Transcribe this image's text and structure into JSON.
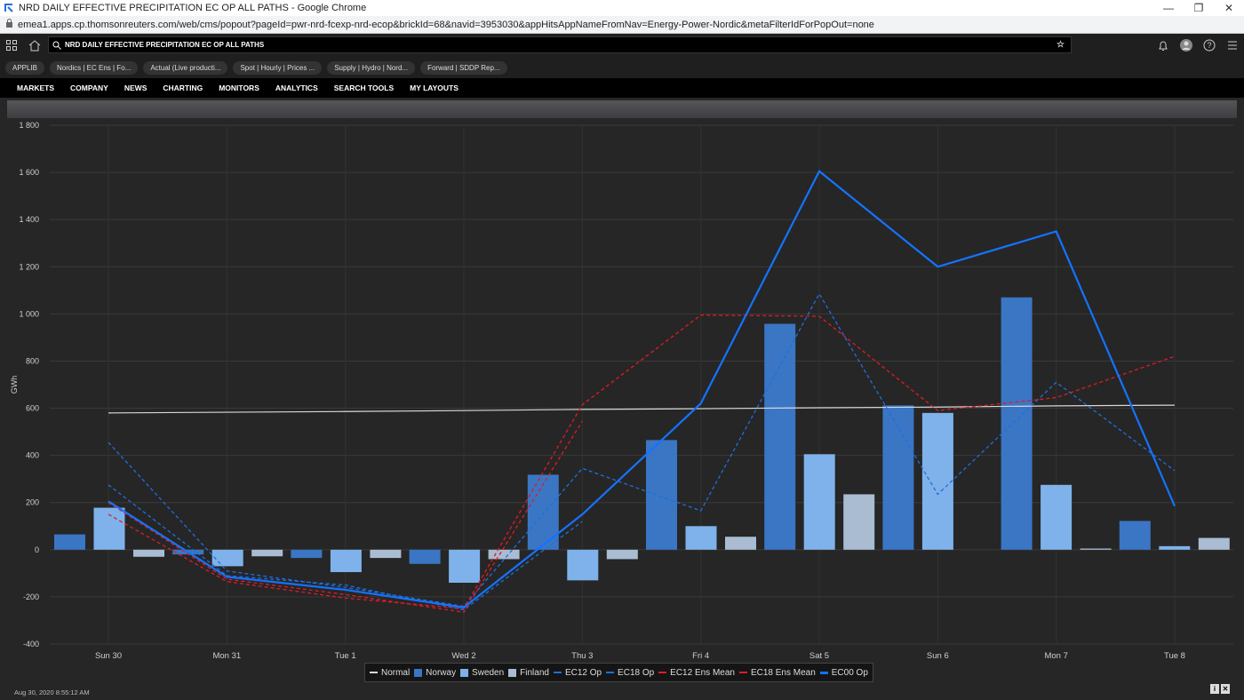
{
  "window": {
    "title": "NRD DAILY EFFECTIVE PRECIPITATION EC OP ALL PATHS - Google Chrome",
    "minimize": "—",
    "maximize": "❐",
    "close": "✕"
  },
  "browser": {
    "url": "emea1.apps.cp.thomsonreuters.com/web/cms/popout?pageId=pwr-nrd-fcexp-nrd-ecop&brickId=68&navid=3953030&appHitsAppNameFromNav=Energy-Power-Nordic&metaFilterIdForPopOut=none"
  },
  "search": {
    "value": "NRD DAILY EFFECTIVE PRECIPITATION EC OP ALL PATHS"
  },
  "tabs": [
    "APPLIB",
    "Nordics | EC Ens | Fo...",
    "Actual (Live producti...",
    "Spot | Hourly | Prices ...",
    "Supply | Hydro | Nord...",
    "Forward | SDDP Rep..."
  ],
  "menu": [
    "MARKETS",
    "COMPANY",
    "NEWS",
    "CHARTING",
    "MONITORS",
    "ANALYTICS",
    "SEARCH TOOLS",
    "MY LAYOUTS"
  ],
  "footer": {
    "timestamp": "Aug 30, 2020 8:55:12 AM"
  },
  "colors": {
    "normal": "#d8d8d8",
    "norway": "#3a76c4",
    "sweden": "#7fb2ea",
    "finland": "#a9bcd2",
    "ec12op": "#1e6fe0",
    "ec18op": "#1e6fe0",
    "ec12mean": "#e01b24",
    "ec18mean": "#e01b24",
    "ec00op": "#1473ff"
  },
  "chart_data": {
    "type": "bar",
    "title": "",
    "ylabel": "GWh",
    "xlabel": "",
    "ylim": [
      -400,
      1800
    ],
    "yticks": [
      1800,
      1600,
      1400,
      1200,
      1000,
      800,
      600,
      400,
      200,
      0,
      -200,
      -400
    ],
    "ytick_labels": [
      "1 800",
      "1 600",
      "1 400",
      "1 200",
      "1 000",
      "800",
      "600",
      "400",
      "200",
      "0",
      "-200",
      "-400"
    ],
    "categories": [
      "Sun 30",
      "Mon 31",
      "Tue 1",
      "Wed 2",
      "Thu 3",
      "Fri 4",
      "Sat 5",
      "Sun 6",
      "Mon 7",
      "Tue 8"
    ],
    "grid": true,
    "legend_position": "bottom",
    "bar_series": [
      {
        "name": "Norway",
        "values": [
          65,
          -20,
          -35,
          -60,
          318,
          465,
          958,
          612,
          1070,
          122
        ]
      },
      {
        "name": "Sweden",
        "values": [
          178,
          -70,
          -95,
          -140,
          -130,
          100,
          405,
          580,
          275,
          15
        ]
      },
      {
        "name": "Finland",
        "values": [
          -30,
          -28,
          -35,
          -40,
          -40,
          55,
          235,
          null,
          5,
          50
        ]
      }
    ],
    "line_series": [
      {
        "name": "Normal",
        "style": "solid",
        "values": [
          580,
          583,
          586,
          590,
          595,
          598,
          602,
          605,
          610,
          613
        ]
      },
      {
        "name": "EC12 Op",
        "style": "dashed",
        "values": [
          455,
          -90,
          -160,
          -240,
          345,
          165,
          1085,
          235,
          710,
          335
        ]
      },
      {
        "name": "EC18 Op",
        "style": "dashed",
        "values": [
          275,
          -110,
          -150,
          -255,
          120,
          null,
          null,
          null,
          null,
          null
        ]
      },
      {
        "name": "EC12 Ens Mean",
        "style": "dashed",
        "values": [
          150,
          -135,
          -205,
          -250,
          615,
          995,
          990,
          590,
          645,
          820
        ]
      },
      {
        "name": "EC18 Ens Mean",
        "style": "dashed",
        "values": [
          200,
          -125,
          -190,
          -265,
          545,
          null,
          null,
          null,
          null,
          null
        ]
      },
      {
        "name": "EC00 Op",
        "style": "solid",
        "values": [
          205,
          -115,
          -170,
          -245,
          150,
          620,
          1605,
          1200,
          1350,
          185
        ]
      }
    ],
    "legend": [
      "Normal",
      "Norway",
      "Sweden",
      "Finland",
      "EC12 Op",
      "EC18 Op",
      "EC12 Ens Mean",
      "EC18 Ens Mean",
      "EC00 Op"
    ]
  }
}
